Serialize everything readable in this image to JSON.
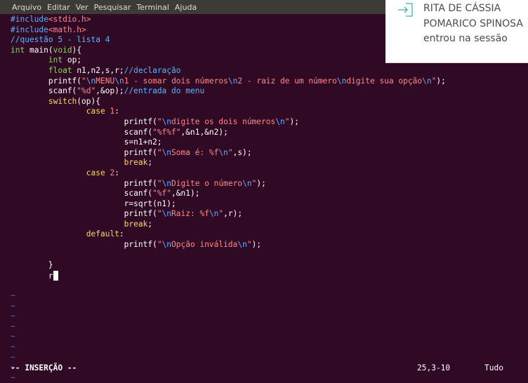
{
  "menubar": {
    "items": [
      "Arquivo",
      "Editar",
      "Ver",
      "Pesquisar",
      "Terminal",
      "Ajuda"
    ]
  },
  "code": [
    [
      {
        "c": "pp",
        "t": "#include"
      },
      {
        "c": "st",
        "t": "<stdio.h>"
      }
    ],
    [
      {
        "c": "pp",
        "t": "#include"
      },
      {
        "c": "st",
        "t": "<math.h>"
      }
    ],
    [
      {
        "c": "cm",
        "t": "//questão 5 - lista 4"
      }
    ],
    [
      {
        "c": "ty",
        "t": "int"
      },
      {
        "c": "",
        "t": " main("
      },
      {
        "c": "ty",
        "t": "void"
      },
      {
        "c": "",
        "t": "){"
      }
    ],
    [
      {
        "c": "",
        "t": "        "
      },
      {
        "c": "ty",
        "t": "int"
      },
      {
        "c": "",
        "t": " op;"
      }
    ],
    [
      {
        "c": "",
        "t": "        "
      },
      {
        "c": "ty",
        "t": "float"
      },
      {
        "c": "",
        "t": " n1,n2,s,r;"
      },
      {
        "c": "cm",
        "t": "//declaração"
      }
    ],
    [
      {
        "c": "",
        "t": "        printf("
      },
      {
        "c": "st",
        "t": "\""
      },
      {
        "c": "pp",
        "t": "\\n"
      },
      {
        "c": "st",
        "t": "MENU"
      },
      {
        "c": "pp",
        "t": "\\n"
      },
      {
        "c": "st",
        "t": "1 - somar dois números"
      },
      {
        "c": "pp",
        "t": "\\n"
      },
      {
        "c": "st",
        "t": "2 - raiz de um número"
      },
      {
        "c": "pp",
        "t": "\\n"
      },
      {
        "c": "st",
        "t": "digite sua opção"
      },
      {
        "c": "pp",
        "t": "\\n"
      },
      {
        "c": "st",
        "t": "\""
      },
      {
        "c": "",
        "t": ");"
      }
    ],
    [
      {
        "c": "",
        "t": "        scanf("
      },
      {
        "c": "st",
        "t": "\"%d\""
      },
      {
        "c": "",
        "t": ",&op);"
      },
      {
        "c": "cm",
        "t": "//entrada do menu"
      }
    ],
    [
      {
        "c": "",
        "t": "        "
      },
      {
        "c": "kw",
        "t": "switch"
      },
      {
        "c": "",
        "t": "(op){"
      }
    ],
    [
      {
        "c": "",
        "t": "                "
      },
      {
        "c": "kw",
        "t": "case"
      },
      {
        "c": "",
        "t": " "
      },
      {
        "c": "st",
        "t": "1"
      },
      {
        "c": "",
        "t": ":"
      }
    ],
    [
      {
        "c": "",
        "t": "                        printf("
      },
      {
        "c": "st",
        "t": "\""
      },
      {
        "c": "pp",
        "t": "\\n"
      },
      {
        "c": "st",
        "t": "digite os dois números"
      },
      {
        "c": "pp",
        "t": "\\n"
      },
      {
        "c": "st",
        "t": "\""
      },
      {
        "c": "",
        "t": ");"
      }
    ],
    [
      {
        "c": "",
        "t": "                        scanf("
      },
      {
        "c": "st",
        "t": "\"%f%f\""
      },
      {
        "c": "",
        "t": ",&n1,&n2);"
      }
    ],
    [
      {
        "c": "",
        "t": "                        s=n1+n2;"
      }
    ],
    [
      {
        "c": "",
        "t": "                        printf("
      },
      {
        "c": "st",
        "t": "\""
      },
      {
        "c": "pp",
        "t": "\\n"
      },
      {
        "c": "st",
        "t": "Soma é: %f"
      },
      {
        "c": "pp",
        "t": "\\n"
      },
      {
        "c": "st",
        "t": "\""
      },
      {
        "c": "",
        "t": ",s);"
      }
    ],
    [
      {
        "c": "",
        "t": "                        "
      },
      {
        "c": "kw",
        "t": "break"
      },
      {
        "c": "",
        "t": ";"
      }
    ],
    [
      {
        "c": "",
        "t": "                "
      },
      {
        "c": "kw",
        "t": "case"
      },
      {
        "c": "",
        "t": " "
      },
      {
        "c": "st",
        "t": "2"
      },
      {
        "c": "",
        "t": ":"
      }
    ],
    [
      {
        "c": "",
        "t": "                        printf("
      },
      {
        "c": "st",
        "t": "\""
      },
      {
        "c": "pp",
        "t": "\\n"
      },
      {
        "c": "st",
        "t": "Digite o número"
      },
      {
        "c": "pp",
        "t": "\\n"
      },
      {
        "c": "st",
        "t": "\""
      },
      {
        "c": "",
        "t": ");"
      }
    ],
    [
      {
        "c": "",
        "t": "                        scanf("
      },
      {
        "c": "st",
        "t": "\"%f\""
      },
      {
        "c": "",
        "t": ",&n1);"
      }
    ],
    [
      {
        "c": "",
        "t": "                        r=sqrt(n1);"
      }
    ],
    [
      {
        "c": "",
        "t": "                        printf("
      },
      {
        "c": "st",
        "t": "\""
      },
      {
        "c": "pp",
        "t": "\\n"
      },
      {
        "c": "st",
        "t": "Raiz: %f"
      },
      {
        "c": "pp",
        "t": "\\n"
      },
      {
        "c": "st",
        "t": "\""
      },
      {
        "c": "",
        "t": ",r);"
      }
    ],
    [
      {
        "c": "",
        "t": "                        "
      },
      {
        "c": "kw",
        "t": "break"
      },
      {
        "c": "",
        "t": ";"
      }
    ],
    [
      {
        "c": "",
        "t": "                "
      },
      {
        "c": "kw",
        "t": "default"
      },
      {
        "c": "",
        "t": ":"
      }
    ],
    [
      {
        "c": "",
        "t": "                        printf("
      },
      {
        "c": "st",
        "t": "\""
      },
      {
        "c": "pp",
        "t": "\\n"
      },
      {
        "c": "st",
        "t": "Opção inválida"
      },
      {
        "c": "pp",
        "t": "\\n"
      },
      {
        "c": "st",
        "t": "\""
      },
      {
        "c": "",
        "t": ");"
      }
    ],
    [
      {
        "c": "",
        "t": ""
      }
    ],
    [
      {
        "c": "",
        "t": "        }"
      }
    ],
    [
      {
        "c": "",
        "t": "        r"
      },
      {
        "c": "cursor",
        "t": ""
      }
    ],
    [
      {
        "c": "",
        "t": ""
      }
    ],
    [
      {
        "c": "tilde",
        "t": "~"
      }
    ],
    [
      {
        "c": "tilde",
        "t": "~"
      }
    ],
    [
      {
        "c": "tilde",
        "t": "~"
      }
    ],
    [
      {
        "c": "tilde",
        "t": "~"
      }
    ],
    [
      {
        "c": "tilde",
        "t": "~"
      }
    ],
    [
      {
        "c": "tilde",
        "t": "~"
      }
    ],
    [
      {
        "c": "tilde",
        "t": "~"
      }
    ],
    [
      {
        "c": "tilde",
        "t": "~"
      }
    ],
    [
      {
        "c": "tilde",
        "t": "~"
      }
    ]
  ],
  "statusbar": {
    "mode": "-- INSERÇÃO --",
    "position": "25,3-10",
    "scroll": "Tudo"
  },
  "notification": {
    "icon": "login-arrow-icon",
    "line1": "RITA DE CÁSSIA",
    "line2": "POMARICO SPINOSA",
    "line3": "entrou na sessão"
  },
  "colors": {
    "background": "#300a24",
    "menubar": "#3c3b37",
    "preprocessor": "#5fafff",
    "comment": "#55b5ff",
    "type": "#87d75f",
    "string": "#ff8787",
    "keyword": "#ffd75f",
    "tilde": "#4e6cd0"
  }
}
